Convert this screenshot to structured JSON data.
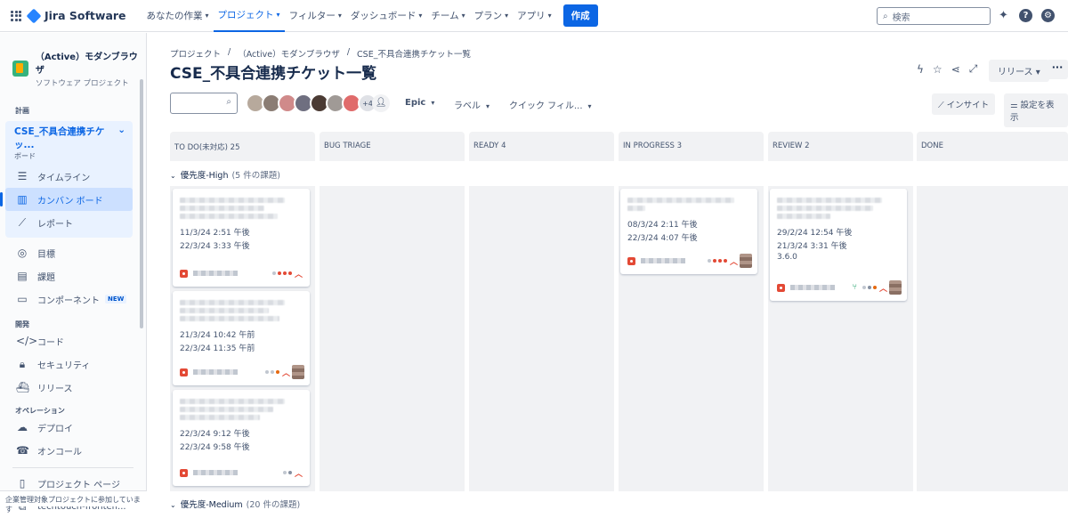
{
  "topnav": {
    "product": "Jira Software",
    "items": [
      {
        "label": "あなたの作業"
      },
      {
        "label": "プロジェクト"
      },
      {
        "label": "フィルター"
      },
      {
        "label": "ダッシュボード"
      },
      {
        "label": "チーム"
      },
      {
        "label": "プラン"
      },
      {
        "label": "アプリ"
      }
    ],
    "create_label": "作成",
    "search_placeholder": "検索"
  },
  "sidebar": {
    "project_name": "（Active）モダンブラウザ",
    "project_type": "ソフトウェア プロジェクト",
    "section_plan": "計画",
    "board_selector": "CSE_不具合連携チケッ...",
    "board_selector_sub": "ボード",
    "plan_items": [
      {
        "label": "タイムライン"
      },
      {
        "label": "カンバン ボード"
      },
      {
        "label": "レポート"
      }
    ],
    "other_items": [
      {
        "label": "目標"
      },
      {
        "label": "課題"
      },
      {
        "label": "コンポーネント"
      }
    ],
    "new_badge": "NEW",
    "section_dev": "開発",
    "dev_items": [
      {
        "label": "コード"
      },
      {
        "label": "セキュリティ"
      },
      {
        "label": "リリース"
      }
    ],
    "section_ops": "オペレーション",
    "ops_items": [
      {
        "label": "デプロイ"
      },
      {
        "label": "オンコール"
      }
    ],
    "bottom_items": [
      {
        "label": "プロジェクト ページ"
      },
      {
        "label": "techtouch-fronten..."
      }
    ],
    "footer": "企業管理対象プロジェクトに参加しています"
  },
  "main": {
    "breadcrumb": [
      "プロジェクト",
      "/",
      "（Active）モダンブラウザ",
      "/",
      "CSE_不具合連携チケット一覧"
    ],
    "title": "CSE_不具合連携チケット一覧",
    "release_label": "リリース",
    "avatar_more": "+4",
    "filters": {
      "epic": "Epic",
      "label": "ラベル",
      "quick": "クイック フィル..."
    },
    "insight_label": "インサイト",
    "view_settings_label": "設定を表示",
    "columns": [
      {
        "name": "TO DO(未対応) 25"
      },
      {
        "name": "BUG TRIAGE"
      },
      {
        "name": "READY 4"
      },
      {
        "name": "IN PROGRESS 3"
      },
      {
        "name": "REVIEW 2"
      },
      {
        "name": "DONE"
      }
    ],
    "swimlanes": [
      {
        "name": "優先度-High",
        "count": "(5 件の課題)"
      },
      {
        "name": "優先度-Medium",
        "count": "(20 件の課題)"
      }
    ],
    "cards": [
      {
        "date1": "11/3/24 2:51 午後",
        "date2": "22/3/24 3:33 午後"
      },
      {
        "date1": "21/3/24 10:42 午前",
        "date2": "22/3/24 11:35 午前"
      },
      {
        "date1": "22/3/24 9:12 午後",
        "date2": "22/3/24 9:58 午後"
      },
      {
        "date1": "08/3/24 2:11 午後",
        "date2": "22/3/24 4:07 午後"
      },
      {
        "date1": "29/2/24 12:54 午後",
        "date2": "21/3/24 3:31 午後",
        "version": "3.6.0"
      }
    ]
  },
  "colors": {
    "accent": "#0c66e4",
    "bug": "#e34935",
    "column_bg": "#f1f2f4"
  }
}
